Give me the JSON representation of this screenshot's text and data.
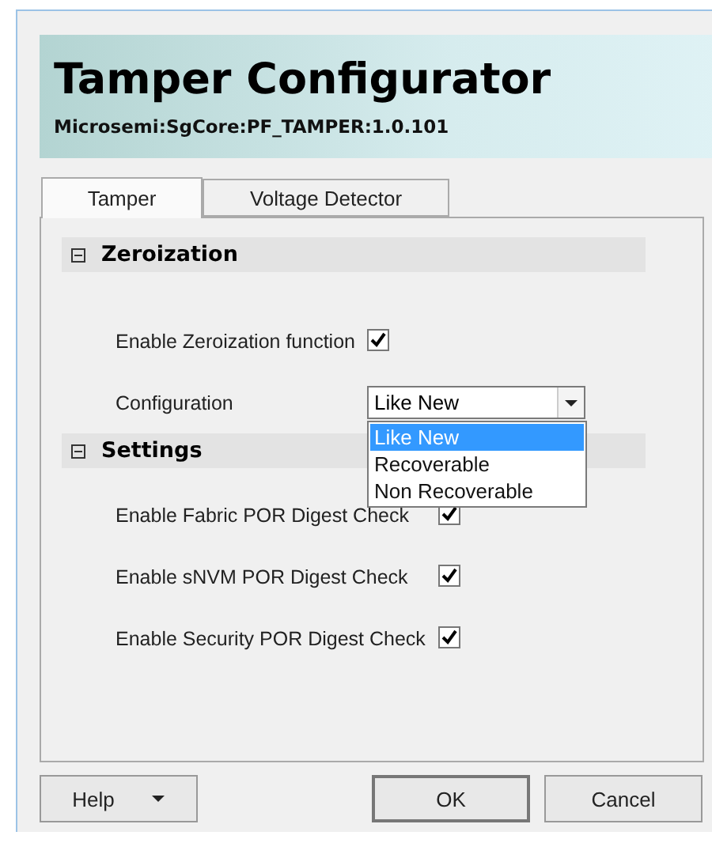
{
  "header": {
    "title": "Tamper Configurator",
    "subtitle": "Microsemi:SgCore:PF_TAMPER:1.0.101"
  },
  "tabs": [
    {
      "label": "Tamper",
      "selected": true
    },
    {
      "label": "Voltage Detector",
      "selected": false
    }
  ],
  "sections": [
    {
      "title": "Zeroization",
      "expanded": true,
      "fields": [
        {
          "kind": "checkbox",
          "label": "Enable Zeroization function",
          "checked": true
        },
        {
          "kind": "dropdown",
          "label": "Configuration",
          "value": "Like New",
          "open": true,
          "options": [
            {
              "label": "Like New",
              "selected": true
            },
            {
              "label": "Recoverable",
              "selected": false
            },
            {
              "label": "Non Recoverable",
              "selected": false
            }
          ]
        }
      ]
    },
    {
      "title": "Settings",
      "expanded": true,
      "fields": [
        {
          "kind": "checkbox",
          "label": "Enable Fabric POR Digest Check",
          "checked": true
        },
        {
          "kind": "checkbox",
          "label": "Enable sNVM POR Digest Check",
          "checked": true
        },
        {
          "kind": "checkbox",
          "label": "Enable Security POR Digest Check",
          "checked": true
        }
      ]
    }
  ],
  "buttons": [
    {
      "label": "Help",
      "kind": "menu"
    },
    {
      "label": "OK",
      "kind": "default"
    },
    {
      "label": "Cancel",
      "kind": "plain"
    }
  ]
}
